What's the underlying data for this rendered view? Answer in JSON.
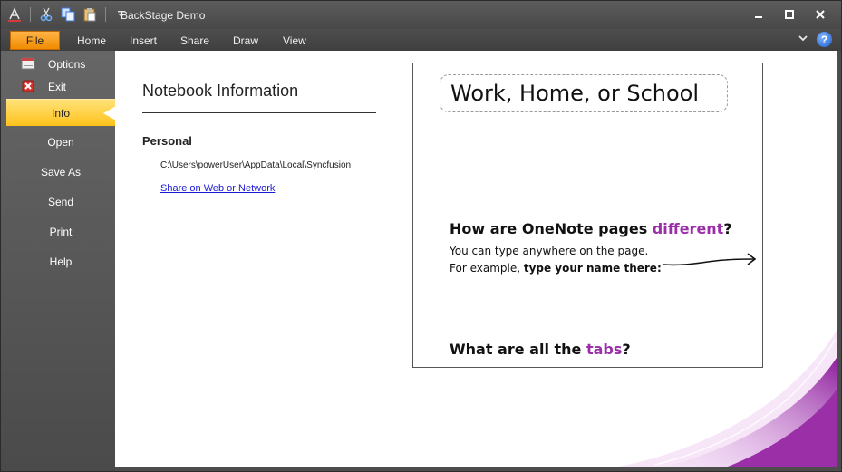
{
  "window": {
    "title": "BackStage Demo",
    "controls": {
      "minimize": "▬",
      "maximize": "■",
      "close": "✕"
    }
  },
  "quick_access": {
    "icons": [
      "font-color-icon",
      "cut-icon",
      "copy-icon",
      "paste-icon",
      "customize-dropdown-icon"
    ]
  },
  "ribbon": {
    "file_tab": "File",
    "tabs": [
      "Home",
      "Insert",
      "Share",
      "Draw",
      "View"
    ],
    "help": "?",
    "collapse": "⌄"
  },
  "backstage": {
    "commands": [
      {
        "label": "Options",
        "icon": "options-icon"
      },
      {
        "label": "Exit",
        "icon": "exit-icon"
      }
    ],
    "nav": [
      {
        "label": "Info",
        "active": true
      },
      {
        "label": "Open",
        "active": false
      },
      {
        "label": "Save As",
        "active": false
      },
      {
        "label": "Send",
        "active": false
      },
      {
        "label": "Print",
        "active": false
      },
      {
        "label": "Help",
        "active": false
      }
    ]
  },
  "info": {
    "heading": "Notebook Information",
    "section": "Personal",
    "path": "C:\\Users\\powerUser\\AppData\\Local\\Syncfusion",
    "share_link": "Share on Web or Network"
  },
  "preview": {
    "title": "Work, Home, or School",
    "q1_prefix": "How are OneNote pages ",
    "q1_highlight": "different",
    "q1_suffix": "?",
    "body1": "You can type anywhere on the page.",
    "body2_prefix": "For example, ",
    "body2_bold": "type your name there:",
    "q2_prefix": "What are all the ",
    "q2_highlight": "tabs",
    "q2_suffix": "?"
  },
  "colors": {
    "file_tab": "#f08c00",
    "active_nav": "#ffc21a",
    "highlight": "#9b2fa8",
    "link": "#1a1ad6",
    "swoosh": "#9b2fa8"
  }
}
